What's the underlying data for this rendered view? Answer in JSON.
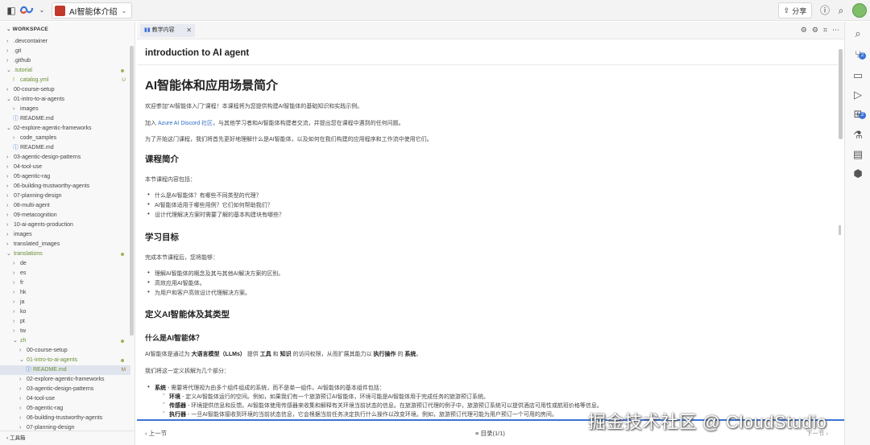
{
  "topbar": {
    "project_name": "AI智能体介绍",
    "share_label": "分享",
    "icons": [
      "panel-toggle-icon",
      "cloudstudio-logo-icon",
      "help-icon",
      "search-icon",
      "avatar"
    ]
  },
  "sidebar": {
    "header": "WORKSPACE",
    "footer": "工具箱",
    "items": [
      {
        "label": ".devcontainer",
        "level": 0,
        "type": "folder"
      },
      {
        "label": ".git",
        "level": 0,
        "type": "folder"
      },
      {
        "label": ".github",
        "level": 0,
        "type": "folder"
      },
      {
        "label": ".tutorial",
        "level": 0,
        "type": "folder-open",
        "status": "dot"
      },
      {
        "label": "catalog.yml",
        "level": 1,
        "type": "file-yml",
        "status": "U"
      },
      {
        "label": "00-course-setup",
        "level": 0,
        "type": "folder"
      },
      {
        "label": "01-intro-to-ai-agents",
        "level": 0,
        "type": "folder-open"
      },
      {
        "label": "images",
        "level": 1,
        "type": "folder"
      },
      {
        "label": "README.md",
        "level": 1,
        "type": "file-md"
      },
      {
        "label": "02-explore-agentic-frameworks",
        "level": 0,
        "type": "folder-open"
      },
      {
        "label": "code_samples",
        "level": 1,
        "type": "folder"
      },
      {
        "label": "README.md",
        "level": 1,
        "type": "file-md"
      },
      {
        "label": "03-agentic-design-patterns",
        "level": 0,
        "type": "folder"
      },
      {
        "label": "04-tool-use",
        "level": 0,
        "type": "folder"
      },
      {
        "label": "05-agentic-rag",
        "level": 0,
        "type": "folder"
      },
      {
        "label": "06-building-trustworthy-agents",
        "level": 0,
        "type": "folder"
      },
      {
        "label": "07-planning-design",
        "level": 0,
        "type": "folder"
      },
      {
        "label": "08-multi-agent",
        "level": 0,
        "type": "folder"
      },
      {
        "label": "09-metacognition",
        "level": 0,
        "type": "folder"
      },
      {
        "label": "10-ai-agents-production",
        "level": 0,
        "type": "folder"
      },
      {
        "label": "images",
        "level": 0,
        "type": "folder"
      },
      {
        "label": "translated_images",
        "level": 0,
        "type": "folder"
      },
      {
        "label": "translations",
        "level": 0,
        "type": "folder-open",
        "status": "dot"
      },
      {
        "label": "de",
        "level": 1,
        "type": "folder"
      },
      {
        "label": "es",
        "level": 1,
        "type": "folder"
      },
      {
        "label": "fr",
        "level": 1,
        "type": "folder"
      },
      {
        "label": "hk",
        "level": 1,
        "type": "folder"
      },
      {
        "label": "ja",
        "level": 1,
        "type": "folder"
      },
      {
        "label": "ko",
        "level": 1,
        "type": "folder"
      },
      {
        "label": "pt",
        "level": 1,
        "type": "folder"
      },
      {
        "label": "tw",
        "level": 1,
        "type": "folder"
      },
      {
        "label": "zh",
        "level": 1,
        "type": "folder-open",
        "status": "dot"
      },
      {
        "label": "00-course-setup",
        "level": 2,
        "type": "folder"
      },
      {
        "label": "01-intro-to-ai-agents",
        "level": 2,
        "type": "folder-open",
        "status": "dot"
      },
      {
        "label": "README.md",
        "level": 3,
        "type": "file-md",
        "status": "M",
        "active": true
      },
      {
        "label": "02-explore-agentic-frameworks",
        "level": 2,
        "type": "folder"
      },
      {
        "label": "03-agentic-design-patterns",
        "level": 2,
        "type": "folder"
      },
      {
        "label": "04-tool-use",
        "level": 2,
        "type": "folder"
      },
      {
        "label": "05-agentic-rag",
        "level": 2,
        "type": "folder"
      },
      {
        "label": "06-building-trustworthy-agents",
        "level": 2,
        "type": "folder"
      },
      {
        "label": "07-planning-design",
        "level": 2,
        "type": "folder"
      }
    ]
  },
  "editor": {
    "tab_label": "教学内容",
    "doc_title": "introduction to AI agent",
    "prev_label": "上一节",
    "toc_label": "目录(1/1)",
    "next_label": "下一节"
  },
  "content": {
    "h1": "AI智能体和应用场景简介",
    "p1": "欢迎参加\"AI智能体入门\"课程！本课程将为您提供构建AI智能体的基础知识和实践示例。",
    "p2_pre": "加入 ",
    "p2_link": "Azure AI Discord 社区",
    "p2_post": "，与其他学习者和AI智能体构建者交流，并提出您在课程中遇到的任何问题。",
    "p3": "为了开始这门课程，我们将首先更好地理解什么是AI智能体，以及如何在我们构建的应用程序和工作流中使用它们。",
    "h2_intro": "课程简介",
    "intro_lead": "本节课程内容包括：",
    "intro_items": [
      "什么是AI智能体？有哪些不同类型的代理？",
      "AI智能体适用于哪些用例？它们如何帮助我们？",
      "设计代理解决方案时需要了解的基本构建块有哪些？"
    ],
    "h2_goals": "学习目标",
    "goals_lead": "完成本节课程后，您将能够：",
    "goals_items": [
      "理解AI智能体的概念及其与其他AI解决方案的区别。",
      "高效应用AI智能体。",
      "为用户和客户高效设计代理解决方案。"
    ],
    "h2_define": "定义AI智能体及其类型",
    "h3_what": "什么是AI智能体？",
    "def_a": "AI智能体是通过为 ",
    "def_b": "大语言模型（LLMs）",
    "def_c": " 提供 ",
    "def_d": "工具",
    "def_e": " 和 ",
    "def_f": "知识",
    "def_g": " 的访问权限，从而扩展其能力以 ",
    "def_h": "执行操作",
    "def_i": " 的 ",
    "def_j": "系统",
    "def_k": "。",
    "breakdown": "我们将这一定义拆解为几个部分：",
    "sys_b": "系统",
    "sys_t": " - 需要将代理视为由多个组件组成的系统，而不是单一组件。AI智能体的基本组件包括：",
    "env_b": "环境",
    "env_t": " - 定义AI智能体运行的空间。例如，如果我们有一个旅游预订AI智能体，环境可能是AI智能体用于完成任务的旅游预订系统。",
    "sen_b": "传感器",
    "sen_t": " - 环境提供信息和反馈。AI智能体使用传感器来收集和解释有关环境当前状态的信息。在旅游预订代理的例子中，旅游预订系统可以提供酒店可用性或航班价格等信息。",
    "act_b": "执行器",
    "act_t": " - 一旦AI智能体接收到环境的当前状态信息，它会根据当前任务决定执行什么操作以改变环境。例如，旅游预订代理可能为用户预订一个可用的房间。"
  },
  "watermark": "掘金技术社区 @ CloudStudio"
}
